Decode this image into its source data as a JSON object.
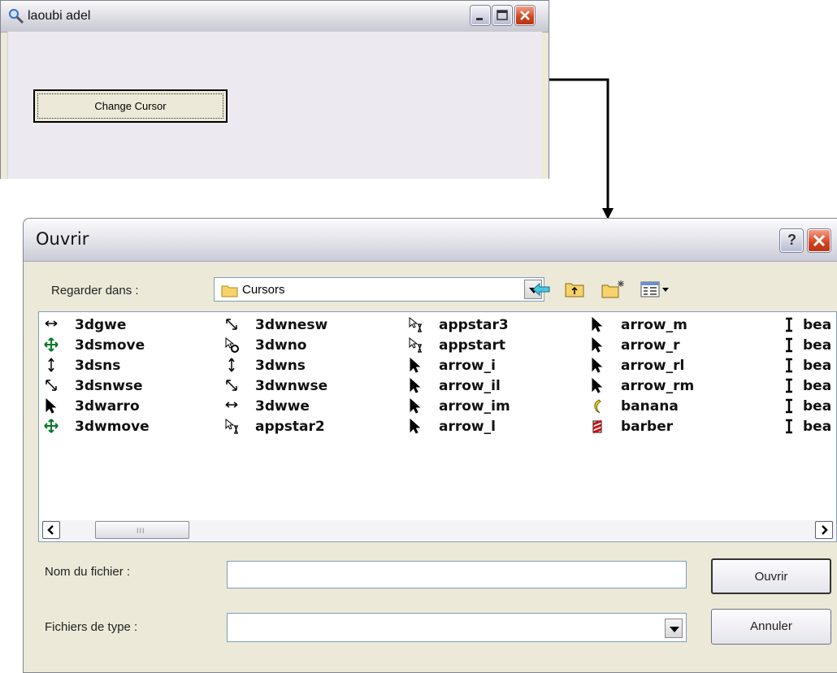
{
  "main_window": {
    "title": "laoubi adel",
    "change_cursor_label": "Change Cursor"
  },
  "open_dialog": {
    "title": "Ouvrir",
    "help_label": "?",
    "look_in_label": "Regarder dans :",
    "look_in_value": "Cursors",
    "file_name_label": "Nom du fichier :",
    "file_name_value": "",
    "file_type_label": "Fichiers de type :",
    "file_type_value": "",
    "open_button_label": "Ouvrir",
    "cancel_button_label": "Annuler",
    "scroll_grip": "III",
    "files": [
      {
        "name": "3dgwe",
        "icon": "horizontal-resize-cursor-icon"
      },
      {
        "name": "3dsmove",
        "icon": "move-cursor-icon"
      },
      {
        "name": "3dsns",
        "icon": "vertical-resize-cursor-icon"
      },
      {
        "name": "3dsnwse",
        "icon": "diagonal-resize-cursor-icon"
      },
      {
        "name": "3dwarro",
        "icon": "arrow-cursor-icon"
      },
      {
        "name": "3dwmove",
        "icon": "move-cursor-icon"
      },
      {
        "name": "3dwnesw",
        "icon": "diagonal-resize-cursor-icon"
      },
      {
        "name": "3dwno",
        "icon": "unavailable-cursor-icon"
      },
      {
        "name": "3dwns",
        "icon": "vertical-resize-cursor-icon"
      },
      {
        "name": "3dwnwse",
        "icon": "diagonal-resize-cursor-icon"
      },
      {
        "name": "3dwwe",
        "icon": "horizontal-resize-cursor-icon"
      },
      {
        "name": "appstar2",
        "icon": "working-cursor-icon"
      },
      {
        "name": "appstar3",
        "icon": "working-cursor-icon"
      },
      {
        "name": "appstart",
        "icon": "working-cursor-icon"
      },
      {
        "name": "arrow_i",
        "icon": "arrow-cursor-icon"
      },
      {
        "name": "arrow_il",
        "icon": "arrow-cursor-icon"
      },
      {
        "name": "arrow_im",
        "icon": "arrow-cursor-icon"
      },
      {
        "name": "arrow_l",
        "icon": "arrow-cursor-icon"
      },
      {
        "name": "arrow_m",
        "icon": "arrow-cursor-icon"
      },
      {
        "name": "arrow_r",
        "icon": "arrow-cursor-icon"
      },
      {
        "name": "arrow_rl",
        "icon": "arrow-cursor-icon"
      },
      {
        "name": "arrow_rm",
        "icon": "arrow-cursor-icon"
      },
      {
        "name": "banana",
        "icon": "banana-cursor-icon"
      },
      {
        "name": "barber",
        "icon": "barber-pole-cursor-icon"
      },
      {
        "name": "bea",
        "icon": "text-beam-cursor-icon"
      },
      {
        "name": "bea",
        "icon": "text-beam-cursor-icon"
      },
      {
        "name": "bea",
        "icon": "text-beam-cursor-icon"
      },
      {
        "name": "bea",
        "icon": "text-beam-cursor-icon"
      },
      {
        "name": "bea",
        "icon": "text-beam-cursor-icon"
      },
      {
        "name": "bea",
        "icon": "text-beam-cursor-icon"
      }
    ]
  }
}
